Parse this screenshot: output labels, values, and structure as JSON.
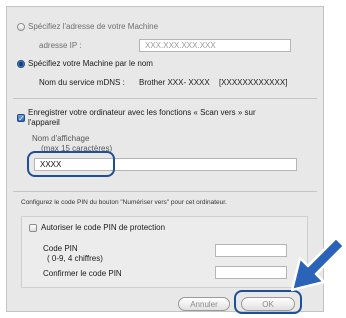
{
  "connection": {
    "radio_address_label": "Spécifiez l'adresse de votre Machine",
    "ip_label": "adresse IP :",
    "ip_placeholder": "XXX.XXX.XXX.XXX",
    "radio_name_label": "Spécifiez votre Machine par le nom",
    "mdns_label": "Nom du service mDNS :",
    "mdns_value": "Brother XXX- XXXX",
    "mdns_value_suffix": "[XXXXXXXXXXXX]"
  },
  "scan_to": {
    "checkbox_label_line1": "Enregistrer votre ordinateur avec les fonctions « Scan vers » sur",
    "checkbox_label_line2": "l'appareil",
    "display_name_label": "Nom d'affichage",
    "display_name_hint": "(max 15 caractères)",
    "display_name_value": "XXXX"
  },
  "pin": {
    "description": "Configurez le code PIN du bouton \"Numériser vers\" pour cet ordinateur.",
    "checkbox_label": "Autoriser le code PIN de protection",
    "code_label": "Code PIN",
    "code_hint": "( 0-9, 4 chiffres)",
    "confirm_label": "Confirmer le code PIN"
  },
  "buttons": {
    "cancel": "Annuler",
    "ok": "OK"
  },
  "colors": {
    "highlight": "#1f4f96",
    "arrow": "#2a63b8"
  }
}
